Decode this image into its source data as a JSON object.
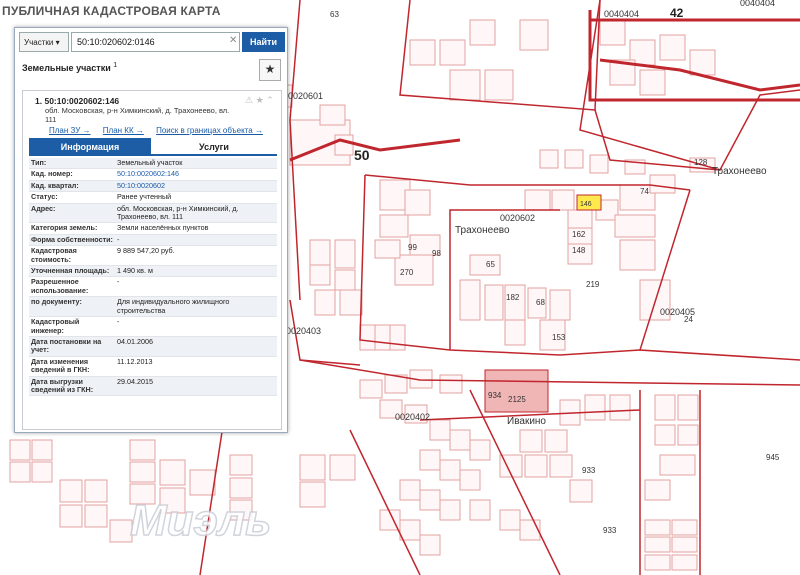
{
  "app": {
    "title": "ПУБЛИЧНАЯ КАДАСТРОВАЯ КАРТА"
  },
  "search": {
    "type_label": "Участки",
    "value": "50:10:020602:0146",
    "button_label": "Найти"
  },
  "section": {
    "title": "Земельные участки",
    "count": "1"
  },
  "result": {
    "number": "1.",
    "cad_number": "50:10:0020602:146",
    "address": "обл. Московская, р-н Химкинский, д. Трахонеево, вл. 111",
    "links": [
      "План ЗУ →",
      "План КК →",
      "Поиск в границах объекта →"
    ],
    "tabs": [
      "Информация",
      "Услуги"
    ],
    "rows": [
      {
        "k": "Тип:",
        "v": "Земельный участок"
      },
      {
        "k": "Кад. номер:",
        "v": "50:10:0020602:146"
      },
      {
        "k": "Кад. квартал:",
        "v": "50:10:0020602"
      },
      {
        "k": "Статус:",
        "v": "Ранее учтенный"
      },
      {
        "k": "Адрес:",
        "v": "обл. Московская, р-н Химкинский, д. Трахонеево, вл. 111"
      },
      {
        "k": "Категория земель:",
        "v": "Земли населённых пунктов"
      },
      {
        "k": "Форма собственности:",
        "v": "-"
      },
      {
        "k": "Кадастровая стоимость:",
        "v": "9 889 547,20 руб."
      },
      {
        "k": "Уточненная площадь:",
        "v": "1 490 кв. м"
      },
      {
        "k": "Разрешенное использование:",
        "v": "-"
      },
      {
        "k": "по документу:",
        "v": "Для индивидуального жилищного строительства"
      },
      {
        "k": "Кадастровый инженер:",
        "v": "-"
      },
      {
        "k": "Дата постановки на учет:",
        "v": "04.01.2006"
      },
      {
        "k": "Дата изменения сведений в ГКН:",
        "v": "11.12.2013"
      },
      {
        "k": "Дата выгрузки сведений из ГКН:",
        "v": "29.04.2015"
      }
    ]
  },
  "map": {
    "labels": {
      "region": "50",
      "region2": "42",
      "q1": "0020601",
      "q2": "0020602",
      "q3": "0020403",
      "q4": "0020402",
      "q5": "0020405",
      "q6": "0040404",
      "q7": "0040404",
      "village1": "Трахонеево",
      "village2": "Трахонеево",
      "village3": "Ивакино",
      "watermark": "Миэль",
      "n63": "63",
      "n146": "146",
      "n65": "65",
      "n270": "270",
      "n934": "934",
      "n2125": "2125",
      "n945": "945",
      "n933": "933",
      "n933b": "933",
      "n24": "24",
      "n128": "128",
      "n74": "74",
      "n162": "162",
      "n148": "148",
      "n219": "219",
      "n68": "68",
      "n153": "153",
      "n182": "182",
      "n99": "99",
      "n98": "98"
    }
  },
  "colors": {
    "accent": "#1d5da6",
    "boundary": "#c0262d",
    "parcel": "#e0a3a3",
    "highlight": "#ffe94d"
  }
}
